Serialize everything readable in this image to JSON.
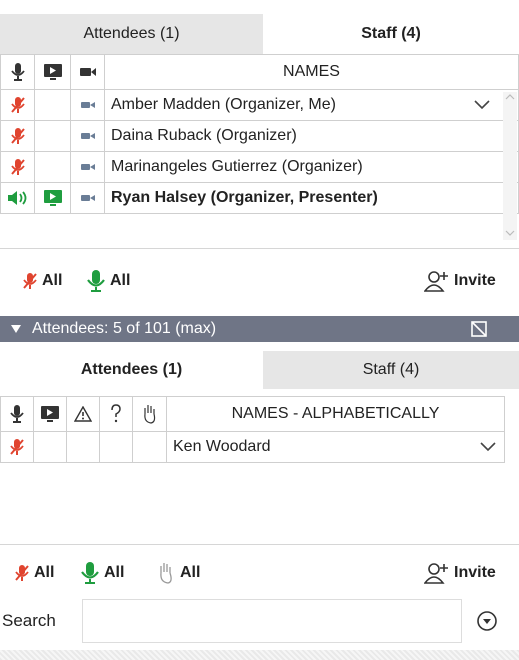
{
  "top_panel": {
    "tabs": [
      {
        "label": "Attendees (1)",
        "active": false
      },
      {
        "label": "Staff (4)",
        "active": true
      }
    ],
    "columns": {
      "names": "NAMES"
    },
    "rows": [
      {
        "mic": "muted",
        "share": "none",
        "cam": "on",
        "name": "Amber Madden (Organizer, Me)",
        "bold": false
      },
      {
        "mic": "muted",
        "share": "none",
        "cam": "on",
        "name": "Daina Ruback (Organizer)",
        "bold": false
      },
      {
        "mic": "muted",
        "share": "none",
        "cam": "on",
        "name": "Marinangeles Gutierrez (Organizer)",
        "bold": false
      },
      {
        "mic": "speaking",
        "share": "presenting",
        "cam": "on",
        "name": "Ryan Halsey (Organizer, Presenter)",
        "bold": true
      }
    ],
    "footer": {
      "mute_all_label": "All",
      "unmute_all_label": "All",
      "invite_label": "Invite"
    }
  },
  "attendees_header": {
    "title": "Attendees:  5 of 101 (max)"
  },
  "bottom_panel": {
    "tabs": [
      {
        "label": "Attendees (1)",
        "active": true
      },
      {
        "label": "Staff (4)",
        "active": false
      }
    ],
    "columns": {
      "names": "NAMES - ALPHABETICALLY"
    },
    "rows": [
      {
        "mic": "muted",
        "name": "Ken Woodard"
      }
    ],
    "footer": {
      "mute_all_label": "All",
      "unmute_all_label": "All",
      "lower_hands_label": "All",
      "invite_label": "Invite"
    },
    "search": {
      "label": "Search",
      "value": "",
      "placeholder": ""
    }
  },
  "colors": {
    "muted_red": "#e0442f",
    "active_green": "#1f9d3f",
    "header_bar": "#6f7586",
    "tab_inactive": "#e6e6e6"
  }
}
